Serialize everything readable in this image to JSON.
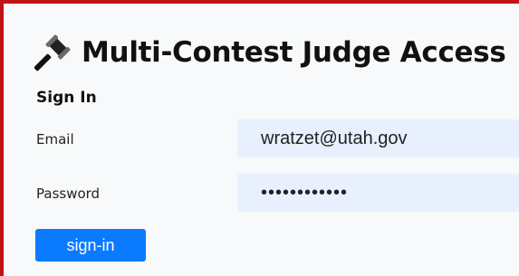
{
  "page": {
    "title": "Multi-Contest Judge Access",
    "title_icon": "gavel-icon",
    "section_heading": "Sign In"
  },
  "form": {
    "email_label": "Email",
    "email_value": "wratzet@utah.gov",
    "password_label": "Password",
    "password_value": "••••••••••••",
    "signin_label": "sign-in"
  },
  "colors": {
    "border": "#c01414",
    "input_background": "#e8f0fe",
    "button_background": "#0a7bff"
  }
}
